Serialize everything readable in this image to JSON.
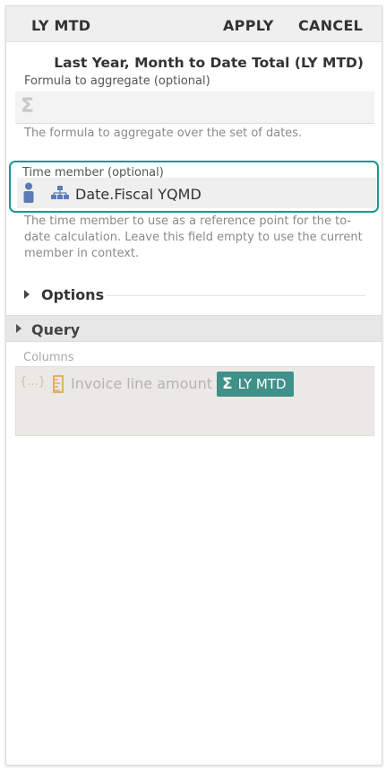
{
  "header": {
    "title": "LY MTD",
    "apply_label": "APPLY",
    "cancel_label": "CANCEL"
  },
  "function_title": "Last Year, Month to Date Total (LY MTD)",
  "formula": {
    "label": "Formula to aggregate (optional)",
    "value": "",
    "icon": "sigma-icon",
    "help": "The formula to aggregate over the set of dates."
  },
  "time_member": {
    "label": "Time member (optional)",
    "value": "Date.Fiscal YQMD",
    "icons": [
      "user-icon",
      "hierarchy-icon"
    ],
    "help": "The time member to use as a reference point for the to-date calculation. Leave this field empty to use the current member in context.",
    "accent_color": "#139a8f"
  },
  "options": {
    "label": "Options"
  },
  "query": {
    "label": "Query"
  },
  "columns": {
    "label": "Columns",
    "brace_text": "{...}",
    "item_label": "Invoice line amount",
    "item_icon": "ruler-icon",
    "chip_label": "LY MTD",
    "chip_icon": "sigma-icon",
    "chip_color": "#3f9088"
  }
}
